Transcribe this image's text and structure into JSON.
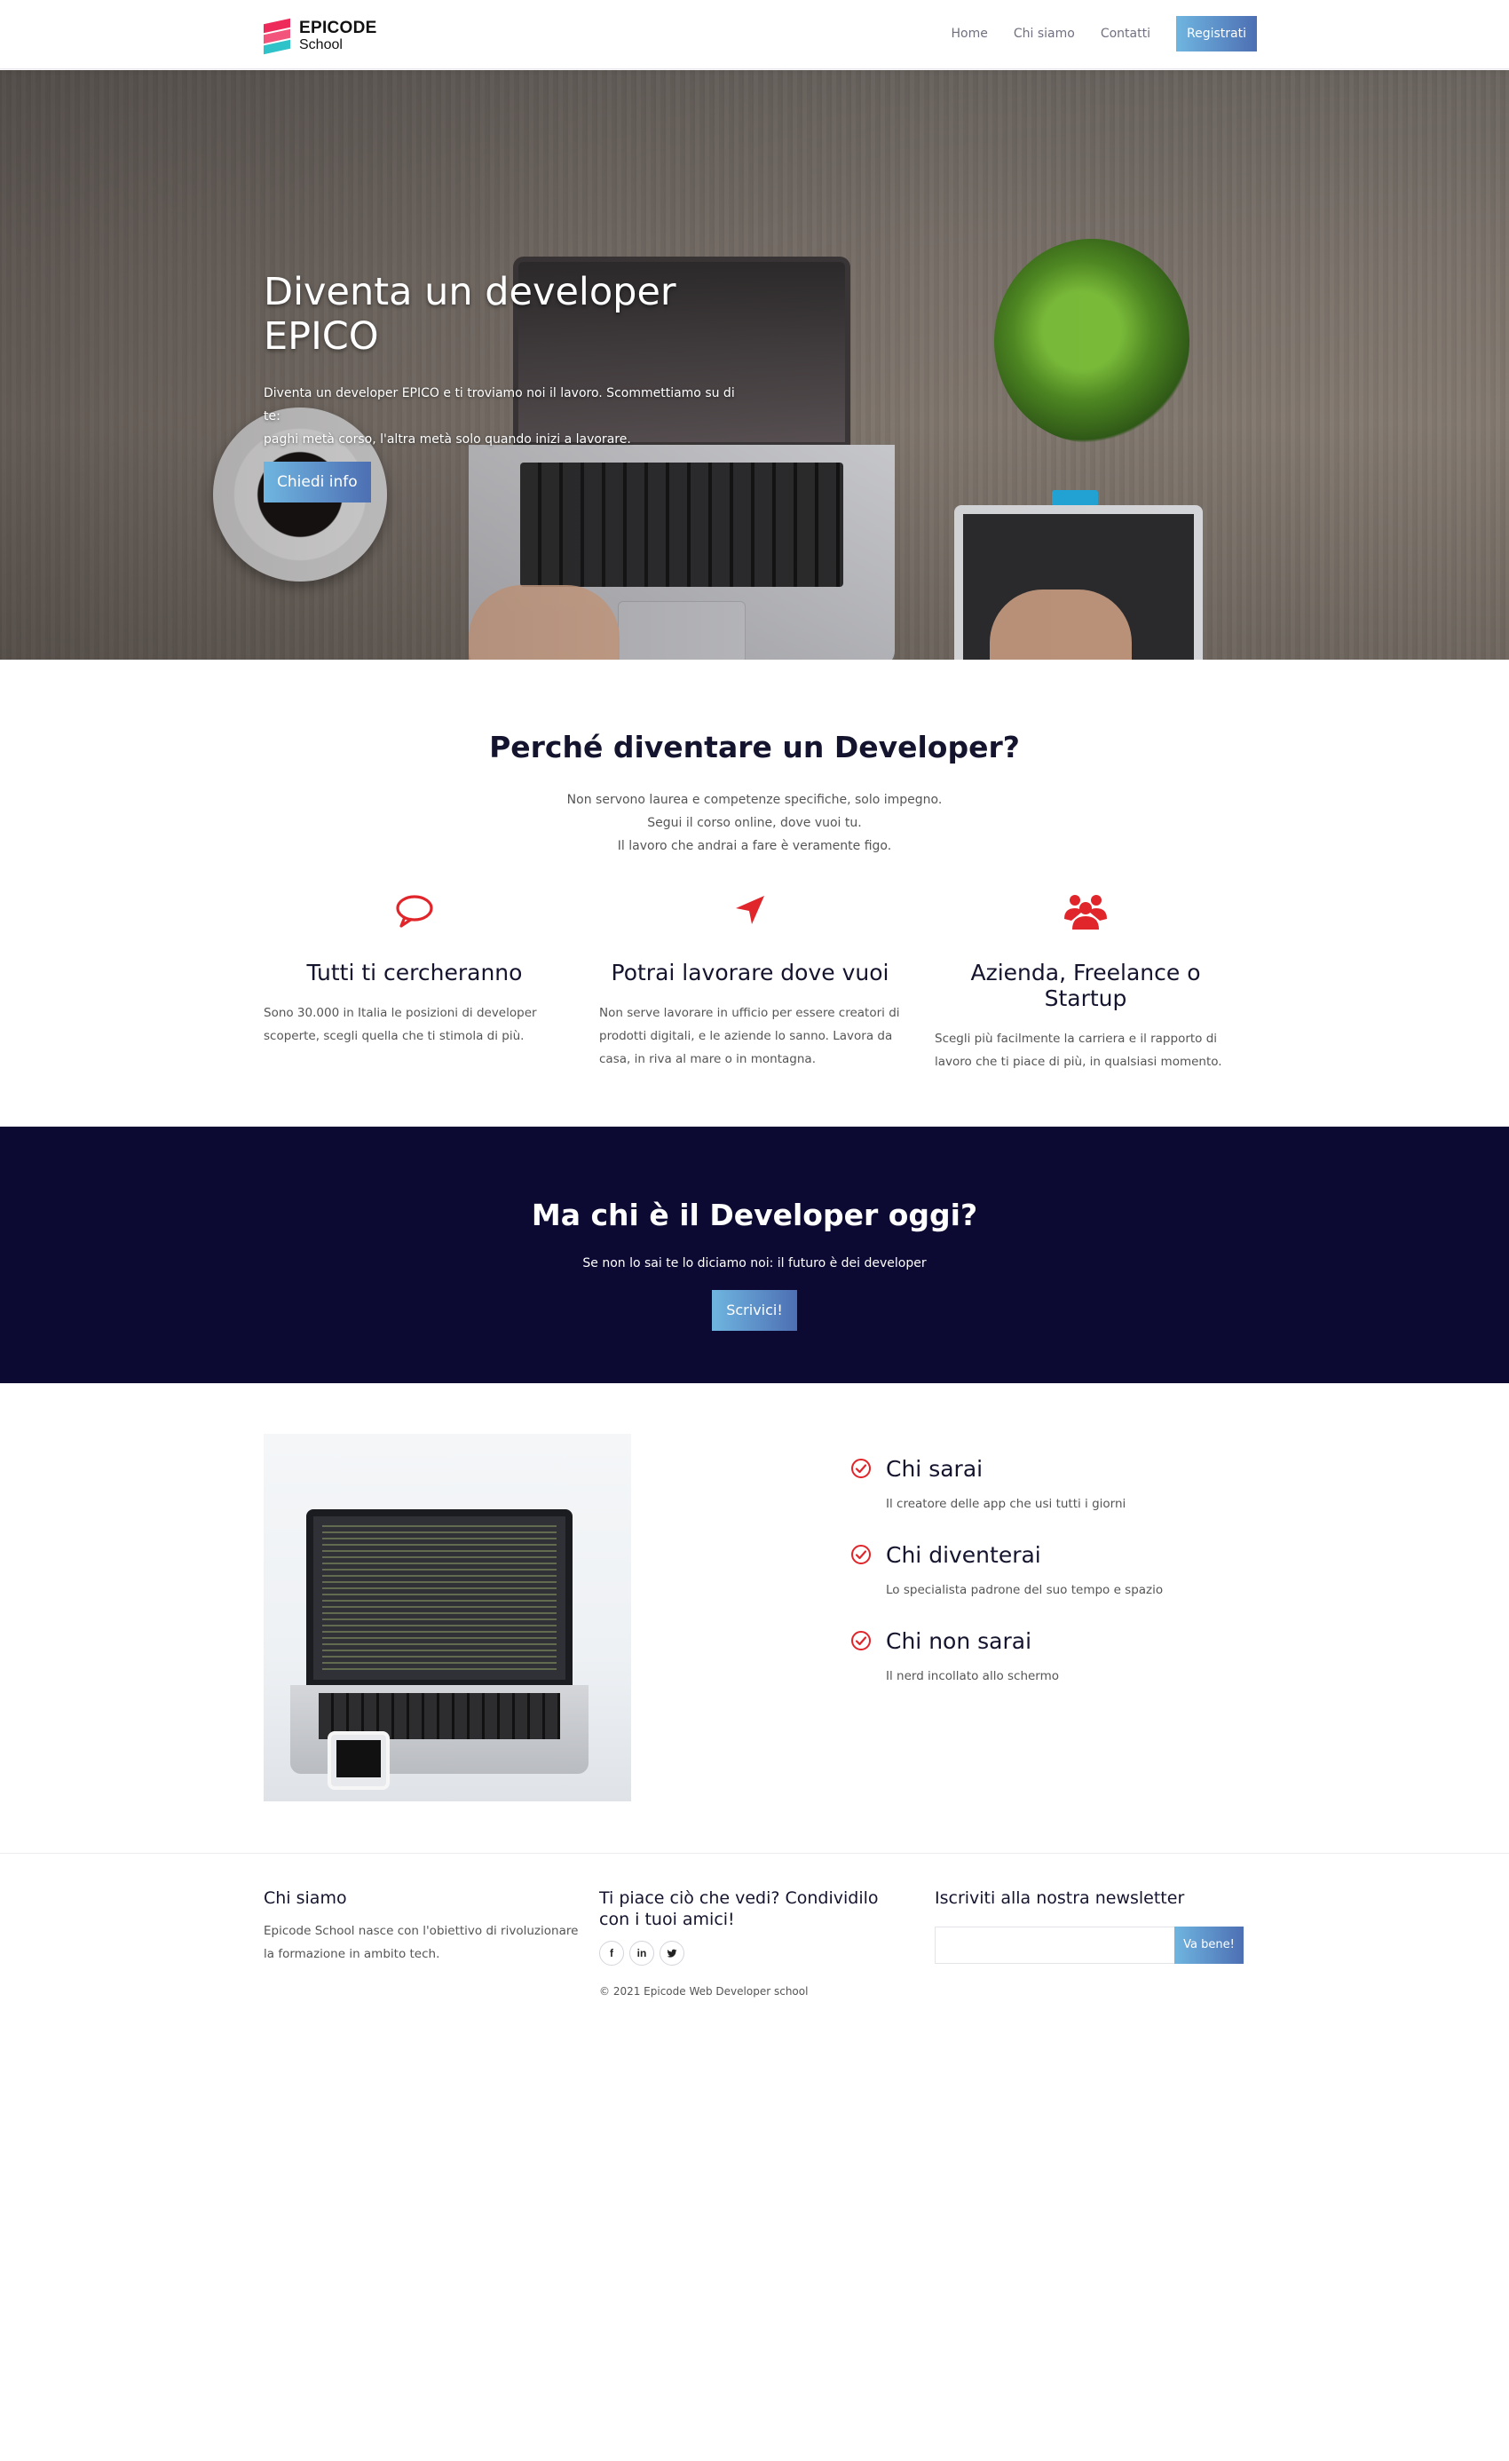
{
  "colors": {
    "accent_gradient_start": "#6fb5e0",
    "accent_gradient_end": "#4d6fb3",
    "icon_red": "#e0262b",
    "band_dark": "#0c0a33",
    "heading": "#15142e"
  },
  "nav": {
    "brand_line1": "EPICODE",
    "brand_line2": "School",
    "links": [
      "Home",
      "Chi siamo",
      "Contatti"
    ],
    "cta": "Registrati"
  },
  "hero": {
    "title_line1": "Diventa un developer",
    "title_line2": "EPICO",
    "text_line1": "Diventa un developer EPICO e ti troviamo noi il lavoro. Scommettiamo su di te:",
    "text_line2": "paghi metà corso, l'altra metà solo quando inizi a lavorare.",
    "button": "Chiedi info"
  },
  "why": {
    "title": "Perché diventare un Developer?",
    "subtitle_lines": [
      "Non servono laurea e competenze specifiche, solo impegno.",
      "Segui il corso online, dove vuoi tu.",
      "Il lavoro che andrai a fare è veramente figo."
    ],
    "features": [
      {
        "icon": "speech-bubble-icon",
        "title": "Tutti ti cercheranno",
        "text": "Sono 30.000 in Italia le posizioni di developer scoperte, scegli quella che ti stimola di più."
      },
      {
        "icon": "location-arrow-icon",
        "title": "Potrai lavorare dove vuoi",
        "text": "Non serve lavorare in ufficio per essere creatori di prodotti digitali, e le aziende lo sanno. Lavora da casa, in riva al mare o in montagna."
      },
      {
        "icon": "users-group-icon",
        "title": "Azienda, Freelance o Startup",
        "text": "Scegli più facilmente la carriera e il rapporto di lavoro che ti piace di più, in qualsiasi momento."
      }
    ]
  },
  "band": {
    "title": "Ma chi è il Developer oggi?",
    "subtitle": "Se non lo sai te lo diciamo noi: il futuro è dei developer",
    "button": "Scrivici!"
  },
  "who": {
    "items": [
      {
        "title": "Chi sarai",
        "text": "Il creatore delle app che usi tutti i giorni"
      },
      {
        "title": "Chi diventerai",
        "text": "Lo specialista padrone del suo tempo e spazio"
      },
      {
        "title": "Chi non sarai",
        "text": "Il nerd incollato allo schermo"
      }
    ]
  },
  "footer": {
    "col1_title": "Chi siamo",
    "col1_text": "Epicode School nasce con l'obiettivo di rivoluzionare la formazione in ambito tech.",
    "col2_title": "Ti piace ciò che vedi? Condividilo con i tuoi amici!",
    "socials": [
      {
        "icon": "facebook-icon",
        "glyph": "f"
      },
      {
        "icon": "linkedin-icon",
        "glyph": "in"
      },
      {
        "icon": "twitter-icon",
        "glyph": "t"
      }
    ],
    "copyright": "© 2021 Epicode Web Developer school",
    "col3_title": "Iscriviti alla nostra newsletter",
    "newsletter_placeholder": "",
    "newsletter_button": "Va bene!"
  }
}
